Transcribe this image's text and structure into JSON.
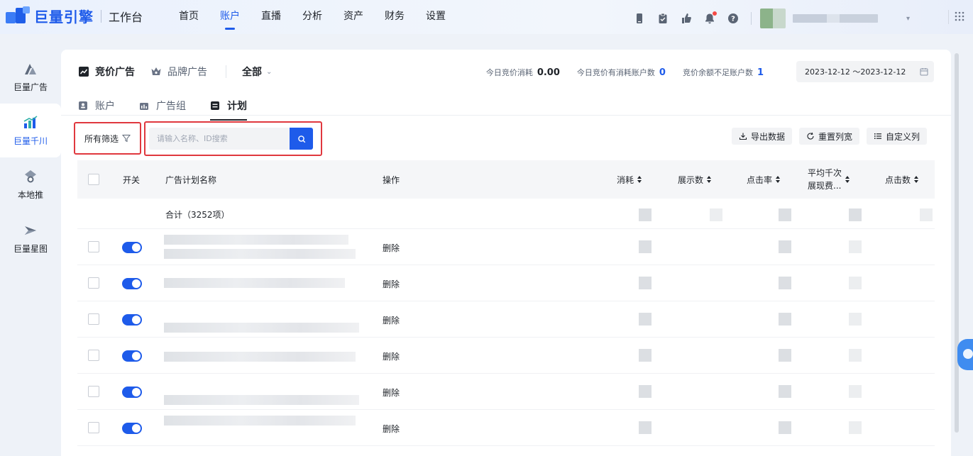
{
  "brand": {
    "name": "巨量引擎",
    "sub": "工作台"
  },
  "top_nav": [
    "首页",
    "账户",
    "直播",
    "分析",
    "资产",
    "财务",
    "设置"
  ],
  "top_nav_active": "账户",
  "side_nav": [
    {
      "label": "巨量广告",
      "icon": "mountain-icon"
    },
    {
      "label": "巨量千川",
      "icon": "qianchuan-icon",
      "active": true
    },
    {
      "label": "本地推",
      "icon": "location-pin-icon"
    },
    {
      "label": "巨量星图",
      "icon": "star-map-icon"
    }
  ],
  "ad_types": {
    "bidding": "竞价广告",
    "brand": "品牌广告",
    "scope": "全部"
  },
  "stats": {
    "today_cost_label": "今日竞价消耗",
    "today_cost_value": "0.00",
    "active_accounts_label": "今日竞价有消耗账户数",
    "active_accounts_value": "0",
    "low_balance_label": "竞价余额不足账户数",
    "low_balance_value": "1"
  },
  "date_range": "2023-12-12 ～2023-12-12",
  "sub_tabs": [
    "账户",
    "广告组",
    "计划"
  ],
  "sub_tab_active": "计划",
  "filter": {
    "label": "所有筛选"
  },
  "search": {
    "placeholder": "请输入名称、ID搜索",
    "value": ""
  },
  "tools": {
    "export": "导出数据",
    "reset_width": "重置列宽",
    "custom_columns": "自定义列"
  },
  "table": {
    "headers": {
      "switch": "开关",
      "name": "广告计划名称",
      "operation": "操作",
      "cost": "消耗",
      "impressions": "展示数",
      "ctr": "点击率",
      "cpm_line1": "平均千次",
      "cpm_line2": "展现费...",
      "clicks": "点击数"
    },
    "total_label": "合计（3252项）",
    "rows": [
      {
        "enabled": true,
        "op": "删除"
      },
      {
        "enabled": true,
        "op": "删除"
      },
      {
        "enabled": true,
        "op": "删除"
      },
      {
        "enabled": true,
        "op": "删除"
      },
      {
        "enabled": true,
        "op": "删除"
      },
      {
        "enabled": true,
        "op": "删除"
      }
    ]
  },
  "colors": {
    "accent": "#1e5bea",
    "highlight_border": "#e0383e"
  }
}
